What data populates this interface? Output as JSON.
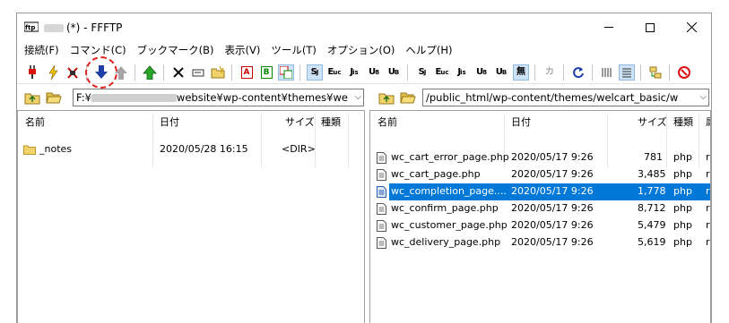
{
  "title": {
    "text": "(*) - FFFTP"
  },
  "menu": [
    "接続(F)",
    "コマンド(C)",
    "ブックマーク(B)",
    "表示(V)",
    "ツール(T)",
    "オプション(O)",
    "ヘルプ(H)"
  ],
  "toolbar": {
    "s_label": "S",
    "e_label": "E",
    "j_label": "J",
    "u_label": "U",
    "a_label": "A",
    "b_label": "B",
    "muu_label": "無",
    "kana_label": "カ"
  },
  "left_path": {
    "value_prefix": "F:¥",
    "value_suffix": "website¥wp-content¥themes¥we"
  },
  "right_path": {
    "value": "/public_html/wp-content/themes/welcart_basic/w"
  },
  "left_pane": {
    "columns": {
      "name": "名前",
      "date": "日付",
      "size": "サイズ",
      "type": "種類"
    },
    "rows": [
      {
        "name": "_notes",
        "date": "2020/05/28 16:15",
        "size": "<DIR>",
        "type": "",
        "kind": "folder"
      }
    ]
  },
  "right_pane": {
    "columns": {
      "name": "名前",
      "date": "日付",
      "size": "サイズ",
      "type": "種類",
      "extra": "属"
    },
    "rows": [
      {
        "name": "wc_cart_error_page.php",
        "date": "2020/05/17  9:26",
        "size": "781",
        "type": "php",
        "extra": "r"
      },
      {
        "name": "wc_cart_page.php",
        "date": "2020/05/17  9:26",
        "size": "3,485",
        "type": "php",
        "extra": "r"
      },
      {
        "name": "wc_completion_page....",
        "date": "2020/05/17  9:26",
        "size": "1,778",
        "type": "php",
        "extra": "r",
        "selected": true
      },
      {
        "name": "wc_confirm_page.php",
        "date": "2020/05/17  9:26",
        "size": "8,712",
        "type": "php",
        "extra": "r"
      },
      {
        "name": "wc_customer_page.php",
        "date": "2020/05/17  9:26",
        "size": "5,479",
        "type": "php",
        "extra": "r"
      },
      {
        "name": "wc_delivery_page.php",
        "date": "2020/05/17  9:26",
        "size": "5,619",
        "type": "php",
        "extra": "r"
      }
    ]
  },
  "colors": {
    "selection": "#0078d7",
    "highlight_circle": "#e0201b",
    "download_arrow": "#1f3fa8",
    "upload_arrow": "#9a9a9a"
  }
}
